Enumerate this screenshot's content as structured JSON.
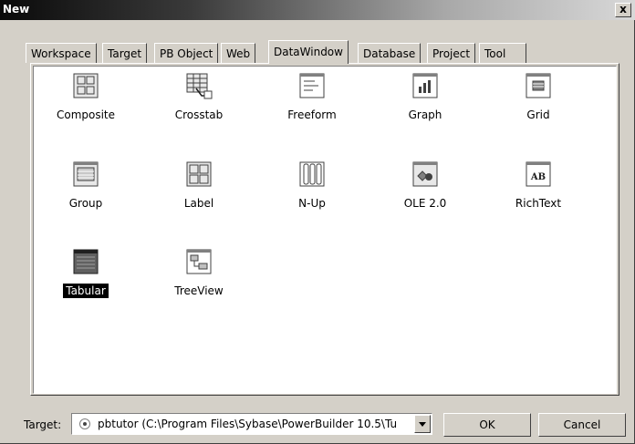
{
  "window": {
    "title": "New",
    "close_label": "x"
  },
  "tabs": [
    "Workspace",
    "Target",
    "PB Object",
    "Web",
    "DataWindow",
    "Database",
    "Project",
    "Tool"
  ],
  "active_tab": "DataWindow",
  "items": [
    {
      "label": "Composite",
      "icon": "composite-icon"
    },
    {
      "label": "Crosstab",
      "icon": "crosstab-icon"
    },
    {
      "label": "Freeform",
      "icon": "freeform-icon"
    },
    {
      "label": "Graph",
      "icon": "graph-icon"
    },
    {
      "label": "Grid",
      "icon": "grid-icon"
    },
    {
      "label": "Group",
      "icon": "group-icon"
    },
    {
      "label": "Label",
      "icon": "label-icon"
    },
    {
      "label": "N-Up",
      "icon": "n-up-icon"
    },
    {
      "label": "OLE 2.0",
      "icon": "ole-icon"
    },
    {
      "label": "RichText",
      "icon": "richtext-icon"
    },
    {
      "label": "Tabular",
      "icon": "tabular-icon"
    },
    {
      "label": "TreeView",
      "icon": "treeview-icon"
    }
  ],
  "selected_item": "Tabular",
  "richtext_icon_text": "AB",
  "footer": {
    "target_label": "Target:",
    "target_value": "pbtutor (C:\\Program Files\\Sybase\\PowerBuilder 10.5\\Tu",
    "ok_label": "OK",
    "cancel_label": "Cancel"
  }
}
